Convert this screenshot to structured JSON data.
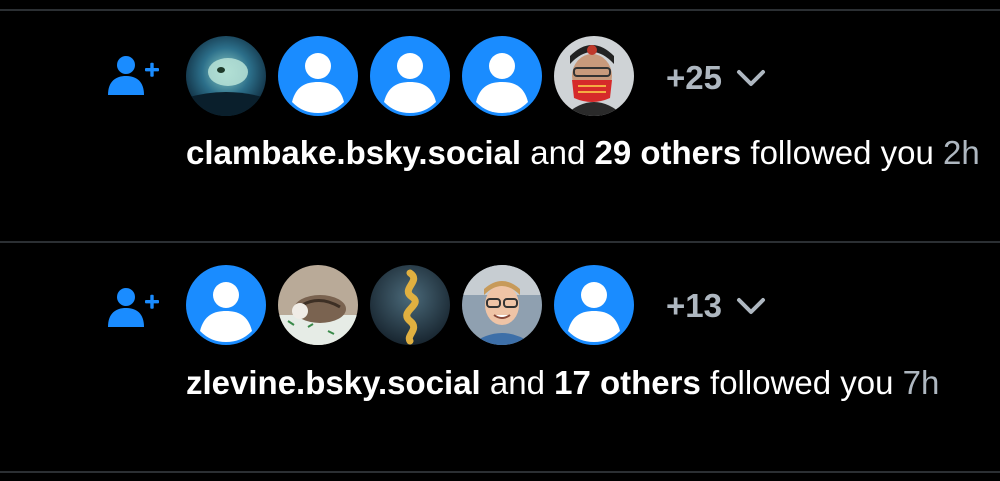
{
  "notifications": [
    {
      "kind": "follow",
      "icon": "person-plus-icon",
      "avatars": [
        "photo-fish",
        "default-avatar",
        "default-avatar",
        "default-avatar",
        "photo-person-red-mask"
      ],
      "more_label": "+25",
      "handle": "clambake.bsky.social",
      "joiner": " and ",
      "others": "29 others",
      "action": " followed you ",
      "time": "2h"
    },
    {
      "kind": "follow",
      "icon": "person-plus-icon",
      "avatars": [
        "default-avatar",
        "photo-cat",
        "photo-gold-snake",
        "photo-smiling-man",
        "default-avatar"
      ],
      "more_label": "+13",
      "handle": "zlevine.bsky.social",
      "joiner": " and ",
      "others": "17 others",
      "action": " followed you ",
      "time": "7h"
    }
  ],
  "colors": {
    "accent": "#1a8cff",
    "background": "#000000",
    "divider": "#2b2f33",
    "muted": "#aeb7c0"
  }
}
